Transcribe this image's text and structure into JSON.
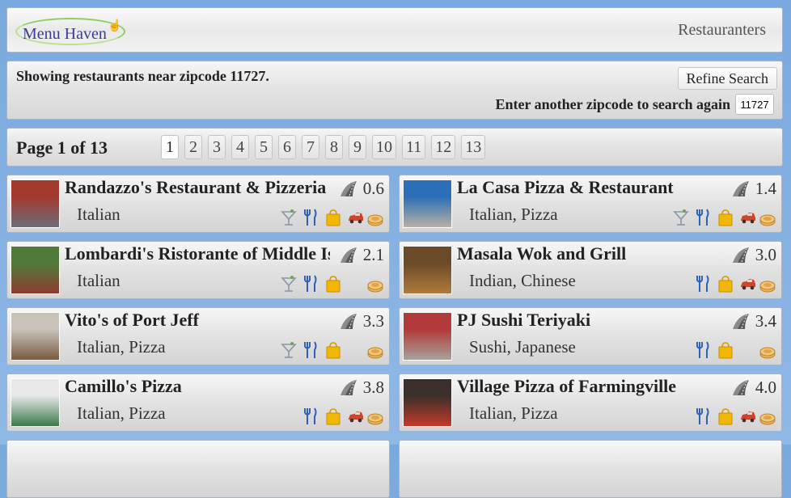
{
  "header": {
    "logo_text": "Menu Haven",
    "restaurateurs_link": "Restauranters"
  },
  "search": {
    "message": "Showing restaurants near zipcode 11727.",
    "refine_label": "Refine Search",
    "zip_prompt": "Enter another zipcode to search again",
    "zip_value": "11727"
  },
  "pager": {
    "title": "Page 1 of 13",
    "pages": [
      "1",
      "2",
      "3",
      "4",
      "5",
      "6",
      "7",
      "8",
      "9",
      "10",
      "11",
      "12",
      "13"
    ],
    "current": "1"
  },
  "restaurants": [
    {
      "name": "Randazzo's Restaurant & Pizzeria",
      "cuisine": "Italian",
      "distance": "0.6",
      "bar": true,
      "dine_in": true,
      "takeout": true,
      "delivery": true,
      "catering": true,
      "thumb_colors": [
        "#a33a2e",
        "#6a6e78"
      ]
    },
    {
      "name": "La Casa Pizza & Restaurant",
      "cuisine": "Italian, Pizza",
      "distance": "1.4",
      "bar": true,
      "dine_in": true,
      "takeout": true,
      "delivery": true,
      "catering": true,
      "thumb_colors": [
        "#2a6fb7",
        "#b8b0a3"
      ]
    },
    {
      "name": "Lombardi's Ristorante of Middle Island",
      "cuisine": "Italian",
      "distance": "2.1",
      "bar": true,
      "dine_in": true,
      "takeout": true,
      "delivery": false,
      "catering": true,
      "thumb_colors": [
        "#4f7a3a",
        "#8e3b32"
      ]
    },
    {
      "name": "Masala Wok and Grill",
      "cuisine": "Indian, Chinese",
      "distance": "3.0",
      "bar": false,
      "dine_in": true,
      "takeout": true,
      "delivery": true,
      "catering": true,
      "thumb_colors": [
        "#6b4a2a",
        "#b07a3a"
      ]
    },
    {
      "name": "Vito's of Port Jeff",
      "cuisine": "Italian, Pizza",
      "distance": "3.3",
      "bar": true,
      "dine_in": true,
      "takeout": true,
      "delivery": false,
      "catering": true,
      "thumb_colors": [
        "#c8c2ba",
        "#7a5b42"
      ]
    },
    {
      "name": "PJ Sushi Teriyaki",
      "cuisine": "Sushi, Japanese",
      "distance": "3.4",
      "bar": false,
      "dine_in": true,
      "takeout": true,
      "delivery": false,
      "catering": true,
      "thumb_colors": [
        "#b23a3a",
        "#a7a29b"
      ]
    },
    {
      "name": "Camillo's Pizza",
      "cuisine": "Italian, Pizza",
      "distance": "3.8",
      "bar": false,
      "dine_in": true,
      "takeout": true,
      "delivery": true,
      "catering": true,
      "thumb_colors": [
        "#e8e8e8",
        "#3a7a4a"
      ]
    },
    {
      "name": "Village Pizza of Farmingville",
      "cuisine": "Italian, Pizza",
      "distance": "4.0",
      "bar": false,
      "dine_in": true,
      "takeout": true,
      "delivery": true,
      "catering": true,
      "thumb_colors": [
        "#3a2f2a",
        "#c43a2a"
      ]
    }
  ]
}
